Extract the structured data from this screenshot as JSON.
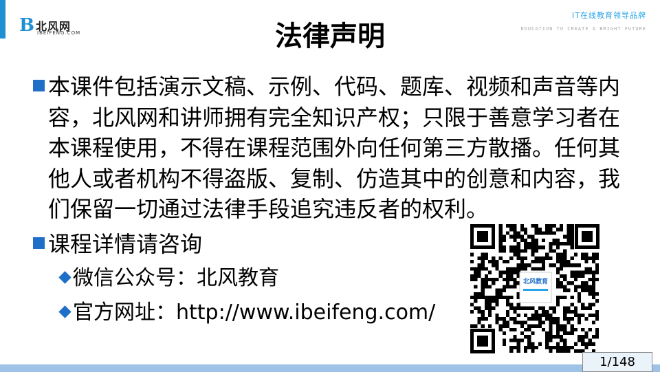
{
  "logo": {
    "mark": "B",
    "cn": "北风网",
    "en": "IBEIFENG.COM"
  },
  "slogan": {
    "cn": "IT在线教育领导品牌",
    "en": "EDUCATION TO CREATE A BRIGHT FUTURE"
  },
  "title": "法律声明",
  "content": {
    "para1": "本课件包括演示文稿、示例、代码、题库、视频和声音等内容，北风网和讲师拥有完全知识产权；只限于善意学习者在本课程使用，不得在课程范围外向任何第三方散播。任何其他人或者机构不得盗版、复制、仿造其中的创意和内容，我们保留一切通过法律手段追究违反者的权利。",
    "bullet2": "课程详情请咨询",
    "sub1": "微信公众号：北风教育",
    "sub2": "官方网址：http://www.ibeifeng.com/"
  },
  "qr": {
    "center_label": "北风教育"
  },
  "page_number": "1/148",
  "colors": {
    "accent": "#1f8fd1",
    "bullet": "#1f6fc9",
    "bar": "#9fc3e6"
  },
  "icons": [
    "square-bullet-icon",
    "diamond-bullet-icon",
    "qr-code"
  ]
}
